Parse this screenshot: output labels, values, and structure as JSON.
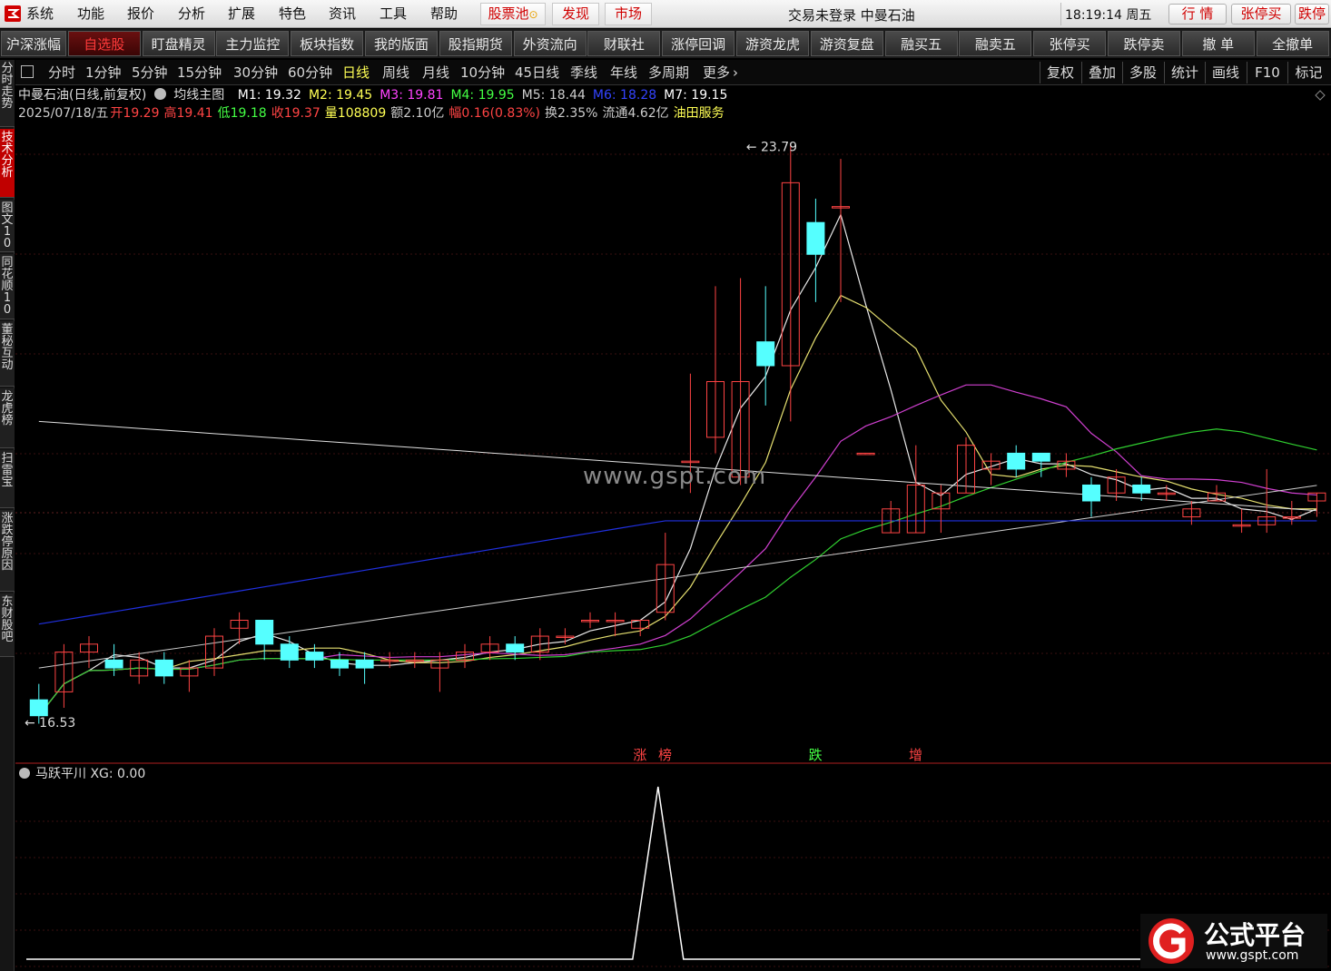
{
  "menu": {
    "items": [
      "系统",
      "功能",
      "报价",
      "分析",
      "扩展",
      "特色",
      "资讯",
      "工具",
      "帮助"
    ],
    "red_items": [
      "股票池",
      "发现",
      "市场"
    ],
    "status": "交易未登录  中曼石油",
    "clock": "18:19:14 周五",
    "trade_buttons": [
      "行 情",
      "张停买",
      "跌停"
    ]
  },
  "toolbar": {
    "buttons": [
      "沪深涨幅",
      "自选股",
      "盯盘精灵",
      "主力监控",
      "板块指数",
      "我的版面",
      "股指期货",
      "外资流向",
      "财联社",
      "涨停回调",
      "游资龙虎",
      "游资复盘",
      "融买五",
      "融卖五",
      "张停买",
      "跌停卖",
      "撤 单",
      "全撤单"
    ],
    "active_index": 1
  },
  "side_tabs": [
    "分时走势",
    "技术分析",
    "图文10",
    "同花顺10",
    "董秘互动",
    "龙虎榜",
    "扫雷宝",
    "涨跌停原因",
    "东财股吧"
  ],
  "side_active_index": 1,
  "periods": [
    "分时",
    "1分钟",
    "5分钟",
    "15分钟",
    "30分钟",
    "60分钟",
    "日线",
    "周线",
    "月线",
    "10分钟",
    "45日线",
    "季线",
    "年线",
    "多周期",
    "更多"
  ],
  "period_active_index": 6,
  "right_tools": [
    "复权",
    "叠加",
    "多股",
    "统计",
    "画线",
    "F10",
    "标记"
  ],
  "info_row1": {
    "stock": "中曼石油(日线,前复权)",
    "indicator": "均线主图",
    "ma": [
      {
        "label": "M1: 19.32",
        "color": "#ffffff"
      },
      {
        "label": "M2: 19.45",
        "color": "#ffff55"
      },
      {
        "label": "M3: 19.81",
        "color": "#ff44ff"
      },
      {
        "label": "M4: 19.95",
        "color": "#44ff44"
      },
      {
        "label": "M5: 18.44",
        "color": "#cccccc"
      },
      {
        "label": "M6: 18.28",
        "color": "#3344ff"
      },
      {
        "label": "M7: 19.15",
        "color": "#ffffff"
      }
    ]
  },
  "info_row2": [
    {
      "text": "2025/07/18/五",
      "color": "#cccccc"
    },
    {
      "text": "开19.29",
      "color": "#ff4444"
    },
    {
      "text": "高19.41",
      "color": "#ff4444"
    },
    {
      "text": "低19.18",
      "color": "#44ff44"
    },
    {
      "text": "收19.37",
      "color": "#ff4444"
    },
    {
      "text": "量108809",
      "color": "#ffff55"
    },
    {
      "text": "额2.10亿",
      "color": "#cccccc"
    },
    {
      "text": "幅0.16(0.83%)",
      "color": "#ff4444"
    },
    {
      "text": "换2.35%",
      "color": "#cccccc"
    },
    {
      "text": "流通4.62亿",
      "color": "#cccccc"
    },
    {
      "text": "油田服务",
      "color": "#ffff55"
    }
  ],
  "chart_data": {
    "type": "candlestick",
    "y_high_label": "23.79",
    "y_low_label": "16.53",
    "price_range": [
      16.3,
      24.0
    ],
    "candles": [
      [
        16.8,
        16.6,
        17.0,
        16.5
      ],
      [
        16.9,
        17.4,
        17.5,
        16.7
      ],
      [
        17.4,
        17.5,
        17.6,
        17.2
      ],
      [
        17.3,
        17.2,
        17.5,
        17.1
      ],
      [
        17.1,
        17.3,
        17.4,
        17.0
      ],
      [
        17.3,
        17.1,
        17.4,
        17.0
      ],
      [
        17.1,
        17.2,
        17.3,
        16.9
      ],
      [
        17.2,
        17.6,
        17.7,
        17.1
      ],
      [
        17.7,
        17.8,
        17.9,
        17.5
      ],
      [
        17.8,
        17.5,
        17.8,
        17.3
      ],
      [
        17.5,
        17.3,
        17.6,
        17.2
      ],
      [
        17.4,
        17.3,
        17.5,
        17.2
      ],
      [
        17.3,
        17.2,
        17.4,
        17.1
      ],
      [
        17.3,
        17.2,
        17.4,
        17.0
      ],
      [
        17.3,
        17.3,
        17.4,
        17.2
      ],
      [
        17.3,
        17.3,
        17.4,
        17.2
      ],
      [
        17.2,
        17.3,
        17.4,
        16.9
      ],
      [
        17.3,
        17.4,
        17.5,
        17.2
      ],
      [
        17.4,
        17.5,
        17.6,
        17.3
      ],
      [
        17.5,
        17.4,
        17.6,
        17.3
      ],
      [
        17.4,
        17.6,
        17.7,
        17.3
      ],
      [
        17.6,
        17.6,
        17.7,
        17.5
      ],
      [
        17.8,
        17.8,
        17.9,
        17.7
      ],
      [
        17.8,
        17.8,
        17.9,
        17.6
      ],
      [
        17.7,
        17.8,
        17.8,
        17.6
      ],
      [
        17.9,
        18.5,
        18.9,
        17.8
      ],
      [
        19.8,
        19.8,
        20.9,
        19.4
      ],
      [
        20.1,
        20.8,
        22.0,
        19.9
      ],
      [
        19.6,
        20.8,
        22.1,
        19.5
      ],
      [
        21.3,
        21.0,
        22.0,
        20.5
      ],
      [
        21.0,
        23.3,
        23.8,
        20.3
      ],
      [
        22.8,
        22.4,
        23.1,
        21.8
      ],
      [
        23.0,
        23.0,
        23.6,
        21.8
      ],
      [
        19.9,
        19.9,
        19.9,
        19.9
      ],
      [
        18.9,
        19.2,
        19.3,
        18.9
      ],
      [
        18.9,
        19.5,
        20.0,
        18.9
      ],
      [
        19.2,
        19.4,
        19.5,
        18.9
      ],
      [
        19.4,
        20.0,
        20.1,
        19.4
      ],
      [
        19.7,
        19.8,
        19.9,
        19.5
      ],
      [
        19.9,
        19.7,
        20.0,
        19.6
      ],
      [
        19.9,
        19.8,
        19.9,
        19.6
      ],
      [
        19.7,
        19.8,
        19.9,
        19.6
      ],
      [
        19.5,
        19.3,
        19.6,
        19.1
      ],
      [
        19.4,
        19.6,
        19.7,
        19.3
      ],
      [
        19.5,
        19.4,
        19.6,
        19.3
      ],
      [
        19.4,
        19.4,
        19.5,
        19.3
      ],
      [
        19.1,
        19.2,
        19.3,
        19.0
      ],
      [
        19.3,
        19.4,
        19.5,
        19.3
      ],
      [
        19.0,
        19.0,
        19.2,
        18.9
      ],
      [
        19.0,
        19.1,
        19.7,
        18.9
      ],
      [
        19.1,
        19.1,
        19.3,
        19.0
      ],
      [
        19.3,
        19.4,
        19.4,
        19.1
      ]
    ],
    "markers": [
      "涨",
      "榜",
      "跌",
      "增"
    ],
    "sub_indicator": "马跃平川 XG: 0.00",
    "xg_signal_index": 25
  },
  "watermark": "www.gspt.com",
  "footer_logo": {
    "title": "公式平台",
    "url": "www.gspt.com"
  },
  "colors": {
    "up": "#ff4444",
    "down": "#55ffff",
    "bg": "#000000"
  }
}
